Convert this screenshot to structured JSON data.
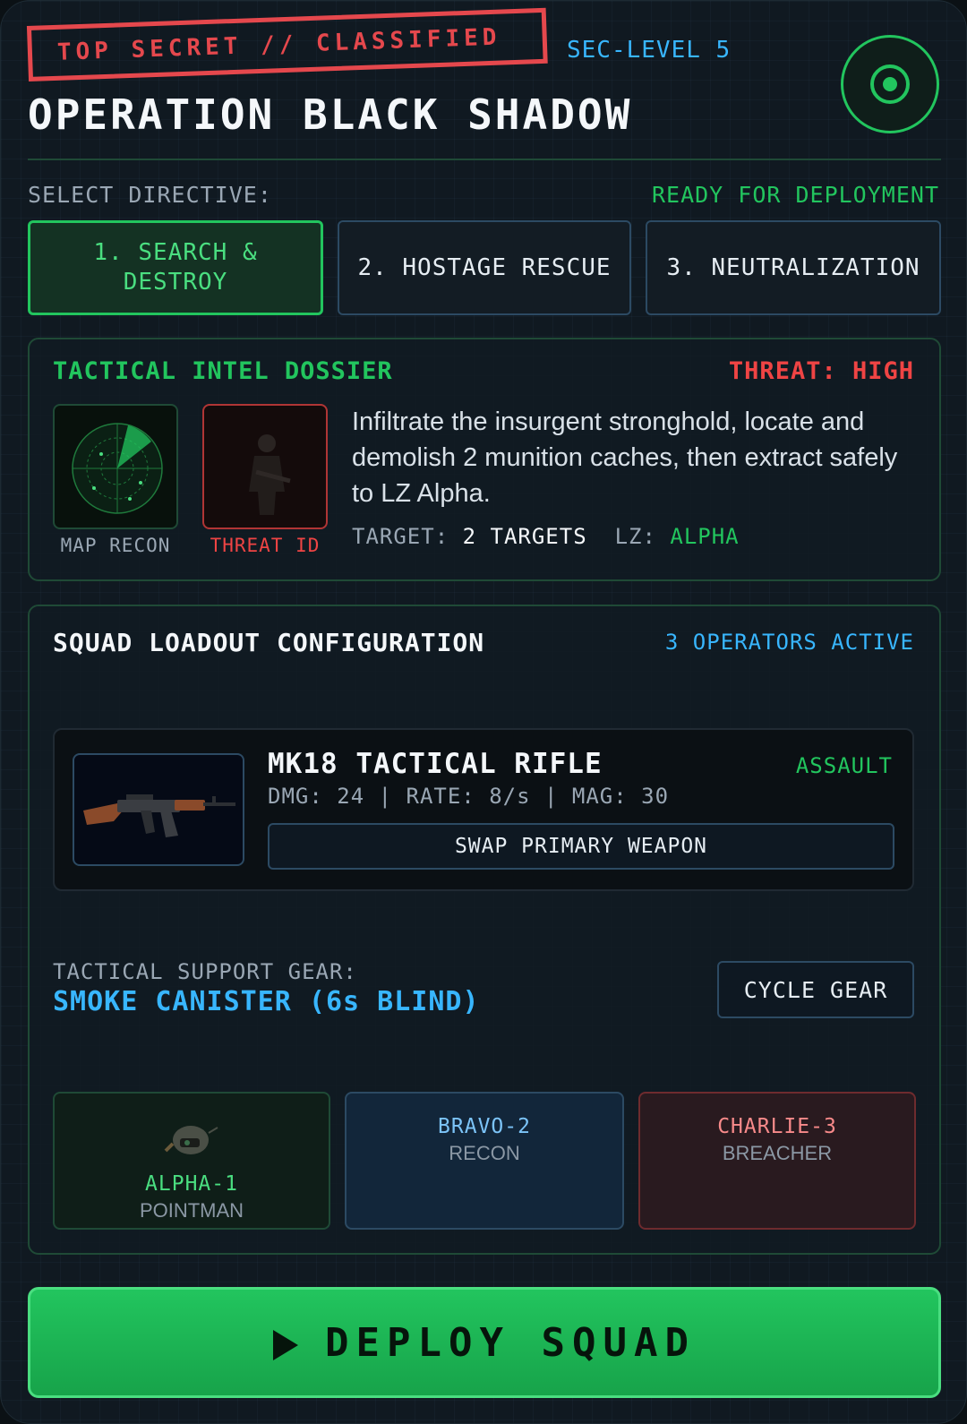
{
  "header": {
    "stamp": "TOP SECRET // CLASSIFIED",
    "sec_level": "SEC-LEVEL 5",
    "title": "OPERATION BLACK SHADOW"
  },
  "directive": {
    "select_label": "SELECT DIRECTIVE:",
    "status": "READY FOR DEPLOYMENT",
    "options": [
      {
        "label": "1. SEARCH & DESTROY",
        "selected": true
      },
      {
        "label": "2. HOSTAGE RESCUE",
        "selected": false
      },
      {
        "label": "3. NEUTRALIZATION",
        "selected": false
      }
    ]
  },
  "intel": {
    "title": "TACTICAL INTEL DOSSIER",
    "threat": "THREAT: HIGH",
    "map_label": "MAP RECON",
    "threat_label": "THREAT ID",
    "briefing": "Infiltrate the insurgent stronghold, locate and demolish 2 munition caches, then extract safely to LZ Alpha.",
    "target_label": "TARGET:",
    "target_value": "2 TARGETS",
    "lz_label": "LZ:",
    "lz_value": "ALPHA"
  },
  "squad": {
    "title": "SQUAD LOADOUT CONFIGURATION",
    "active": "3 OPERATORS ACTIVE",
    "weapon": {
      "name": "MK18 TACTICAL RIFLE",
      "class": "ASSAULT",
      "stats": "DMG: 24 | RATE: 8/s | MAG: 30",
      "swap_label": "SWAP PRIMARY WEAPON"
    },
    "gear": {
      "label": "TACTICAL SUPPORT GEAR:",
      "value": "SMOKE CANISTER (6s BLIND)",
      "cycle_label": "CYCLE GEAR"
    },
    "operators": [
      {
        "callsign": "ALPHA-1",
        "role": "POINTMAN"
      },
      {
        "callsign": "BRAVO-2",
        "role": "RECON"
      },
      {
        "callsign": "CHARLIE-3",
        "role": "BREACHER"
      }
    ]
  },
  "deploy": {
    "label": "DEPLOY SQUAD",
    "icon": "play-icon"
  },
  "colors": {
    "accent": "#22c55e",
    "danger": "#ef4444",
    "info": "#38b6ff",
    "background": "#101921"
  }
}
